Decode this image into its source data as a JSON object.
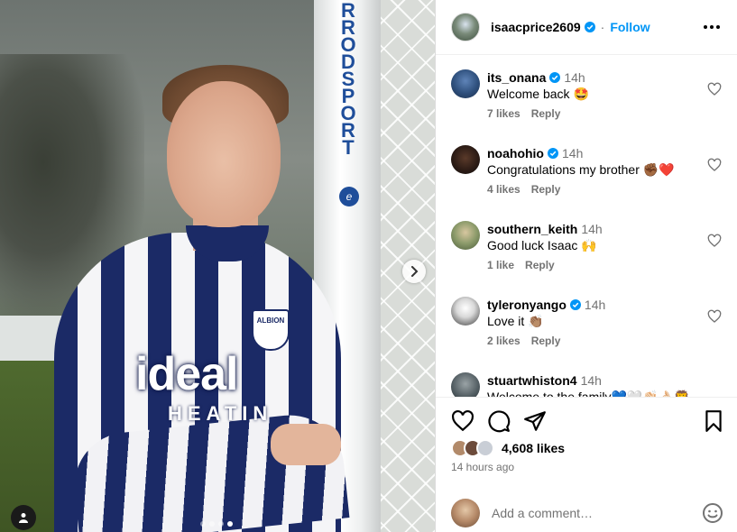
{
  "post": {
    "author": "isaacprice2609",
    "follow_label": "Follow",
    "separator": "·",
    "media": {
      "post_lettering": "RROD SPORT",
      "crest_text": "ALBION",
      "sponsor_text": "ideal",
      "sponsor_subtext": "HEATIN",
      "slide_count": 4,
      "active_slide": 4
    },
    "likes": "4,608 likes",
    "timestamp": "14 hours ago"
  },
  "comments": [
    {
      "user": "its_onana",
      "verified": true,
      "time": "14h",
      "text": "Welcome back 🤩",
      "likes": "7 likes",
      "reply": "Reply"
    },
    {
      "user": "noahohio",
      "verified": true,
      "time": "14h",
      "text": "Congratulations my brother ✊🏾❤️",
      "likes": "4 likes",
      "reply": "Reply"
    },
    {
      "user": "southern_keith",
      "verified": false,
      "time": "14h",
      "text": "Good luck Isaac 🙌",
      "likes": "1 like",
      "reply": "Reply"
    },
    {
      "user": "tyleronyango",
      "verified": true,
      "time": "14h",
      "text": "Love it 👏🏽",
      "likes": "2 likes",
      "reply": "Reply"
    },
    {
      "user": "stuartwhiston4",
      "verified": false,
      "time": "14h",
      "text": "Welcome to the family💙🤍👏🏻👌🏻🦁",
      "likes": "",
      "reply": ""
    }
  ],
  "add_comment": {
    "placeholder": "Add a comment…"
  },
  "colors": {
    "accent": "#0095f6",
    "verified": "#0095f6",
    "muted": "#737373",
    "shirt_navy": "#1b2a66"
  },
  "icons": [
    "verified-badge-icon",
    "more-options-icon",
    "heart-icon",
    "comment-icon",
    "share-icon",
    "bookmark-icon",
    "chevron-right-icon",
    "user-tag-icon",
    "emoji-icon"
  ]
}
